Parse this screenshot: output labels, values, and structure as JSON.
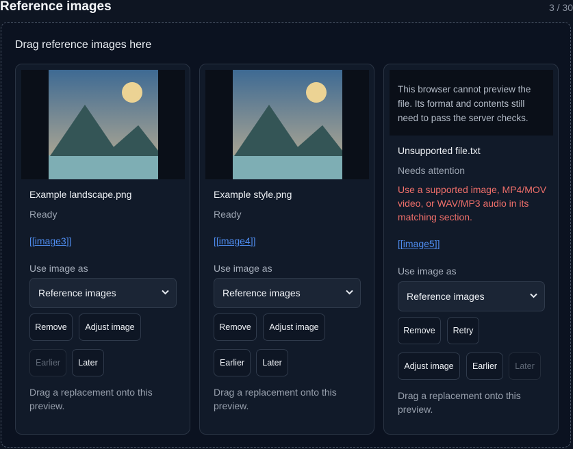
{
  "section": {
    "title": "Reference images",
    "count": "3 / 30"
  },
  "dropzone": {
    "title": "Drag reference images here"
  },
  "cards": [
    {
      "filename": "Example landscape.png",
      "status": "Ready",
      "token": "[[image3]]",
      "use_label": "Use image as",
      "select_value": "Reference images",
      "buttons": {
        "remove": "Remove",
        "adjust": "Adjust image",
        "earlier": "Earlier",
        "later": "Later"
      },
      "hint": "Drag a replacement onto this preview."
    },
    {
      "filename": "Example style.png",
      "status": "Ready",
      "token": "[[image4]]",
      "use_label": "Use image as",
      "select_value": "Reference images",
      "buttons": {
        "remove": "Remove",
        "adjust": "Adjust image",
        "earlier": "Earlier",
        "later": "Later"
      },
      "hint": "Drag a replacement onto this preview."
    },
    {
      "preview_message": "This browser cannot preview the file. Its format and contents still need to pass the server checks.",
      "filename": "Unsupported file.txt",
      "status": "Needs attention",
      "error": "Use a supported image, MP4/MOV video, or WAV/MP3 audio in its matching section.",
      "token": "[[image5]]",
      "use_label": "Use image as",
      "select_value": "Reference images",
      "buttons": {
        "remove": "Remove",
        "retry": "Retry",
        "adjust": "Adjust image",
        "earlier": "Earlier",
        "later": "Later"
      },
      "hint": "Drag a replacement onto this preview."
    }
  ],
  "colors": {
    "background": "#0e1522",
    "card": "#111a29",
    "link": "#4f8df0",
    "error": "#ef6f6a",
    "sky_top": "#3e6a93",
    "sky_bottom": "#a8a493",
    "sun": "#ecd394",
    "mountain": "#345556",
    "water": "#7eaeb4"
  },
  "icons": [
    "landscape-thumbnail",
    "chevron-down-icon"
  ]
}
